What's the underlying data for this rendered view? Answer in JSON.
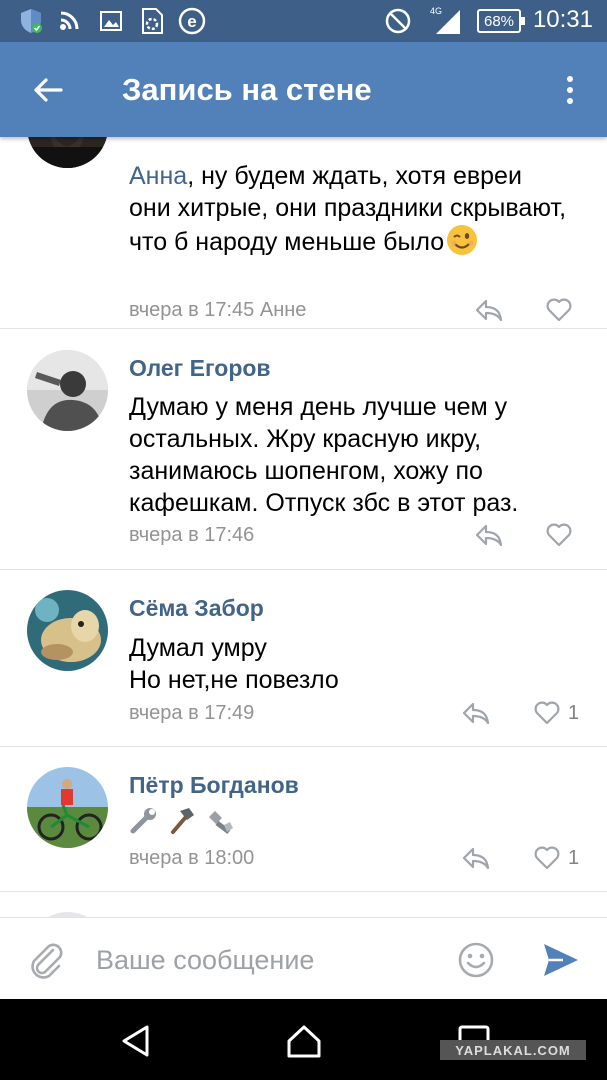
{
  "status_bar": {
    "time": "10:31",
    "battery": "68%",
    "network": "4G",
    "icons": [
      "shield-check-icon",
      "wifi-icon",
      "image-icon",
      "settings-file-icon",
      "e-circle-icon",
      "do-not-disturb-icon",
      "signal-icon",
      "battery-icon"
    ]
  },
  "app_bar": {
    "title": "Запись на стене",
    "back_icon": "arrow-left-icon",
    "menu_icon": "more-vertical-icon"
  },
  "comments": [
    {
      "author": "",
      "mention": "Анна",
      "text_after_mention": ", ну будем ждать, хотя евреи они хитрые, они праздники скрывают, что б народу меньше было",
      "emoji": "winking-face",
      "meta": "вчера в 17:45 Анне",
      "likes": ""
    },
    {
      "author": "Олег Егоров",
      "text": "Думаю у меня день лучше чем у остальных. Жру красную икру, занимаюсь шопенгом, хожу по кафешкам. Отпуск збс в этот раз.",
      "meta": "вчера в 17:46",
      "likes": ""
    },
    {
      "author": "Сёма Забор",
      "text_line1": "Думал умру",
      "text_line2": "Но нет,не повезло",
      "meta": "вчера в 17:49",
      "likes": "1"
    },
    {
      "author": "Пётр Богданов",
      "emojis": [
        "wrench",
        "hammer",
        "nut-and-bolt"
      ],
      "meta": "вчера в 18:00",
      "likes": "1"
    }
  ],
  "input_bar": {
    "placeholder": "Ваше сообщение",
    "value": "",
    "icons": [
      "paperclip-icon",
      "smiley-icon",
      "send-icon"
    ]
  },
  "nav_bar": {
    "icons": [
      "back-triangle-icon",
      "home-icon",
      "recents-square-icon"
    ]
  },
  "watermark": "YAPLAKAL.COM",
  "colors": {
    "status_bar": "#3e5f87",
    "app_bar": "#5181b8",
    "link": "#42648b",
    "meta": "#939393",
    "send": "#5181b8"
  }
}
